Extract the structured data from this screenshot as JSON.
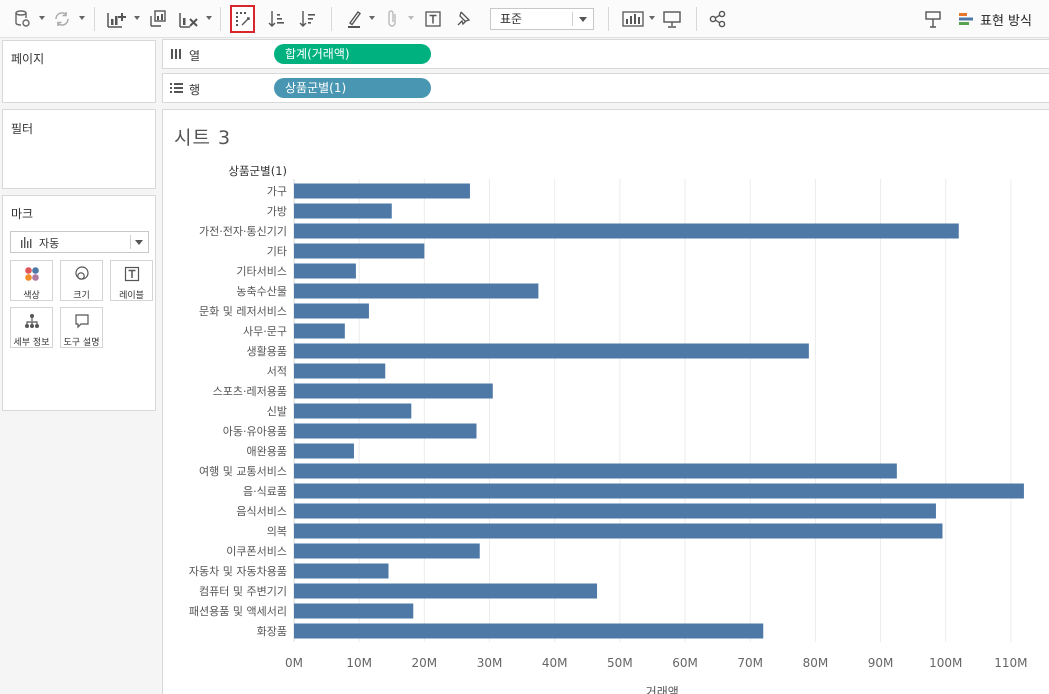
{
  "toolbar": {
    "mark_size_select": "표준",
    "show_me_label": "표현 방식"
  },
  "panels": {
    "pages_title": "페이지",
    "filters_title": "필터",
    "marks_title": "마크",
    "mark_type": "자동",
    "mark_cards": [
      "색상",
      "크기",
      "레이블",
      "세부 정보",
      "도구 설명"
    ]
  },
  "shelves": {
    "columns": {
      "label": "열",
      "pill": "합계(거래액)",
      "pill_color": "#00b180"
    },
    "rows": {
      "label": "행",
      "pill": "상품군별(1)",
      "pill_color": "#4996b2"
    }
  },
  "sheet": {
    "title": "시트 3"
  },
  "chart_data": {
    "type": "bar",
    "orientation": "horizontal",
    "category_header": "상품군별(1)",
    "xlabel": "거래액",
    "xlim": [
      0,
      116000000
    ],
    "x_ticks": [
      "0M",
      "10M",
      "20M",
      "30M",
      "40M",
      "50M",
      "60M",
      "70M",
      "80M",
      "90M",
      "100M",
      "110M"
    ],
    "bar_color": "#4e79a7",
    "grid": true,
    "categories": [
      "가구",
      "가방",
      "가전·전자·통신기기",
      "기타",
      "기타서비스",
      "농축수산물",
      "문화 및 레저서비스",
      "사무·문구",
      "생활용품",
      "서적",
      "스포츠·레저용품",
      "신발",
      "아동·유아용품",
      "애완용품",
      "여행 및 교통서비스",
      "음·식료품",
      "음식서비스",
      "의복",
      "이쿠폰서비스",
      "자동차 및 자동차용품",
      "컴퓨터 및 주변기기",
      "패션용품 및 액세서리",
      "화장품"
    ],
    "values": [
      27000000,
      15000000,
      102000000,
      20000000,
      9500000,
      37500000,
      11500000,
      7800000,
      79000000,
      14000000,
      30500000,
      18000000,
      28000000,
      9200000,
      92500000,
      112000000,
      98500000,
      99500000,
      28500000,
      14500000,
      46500000,
      18300000,
      72000000
    ]
  }
}
